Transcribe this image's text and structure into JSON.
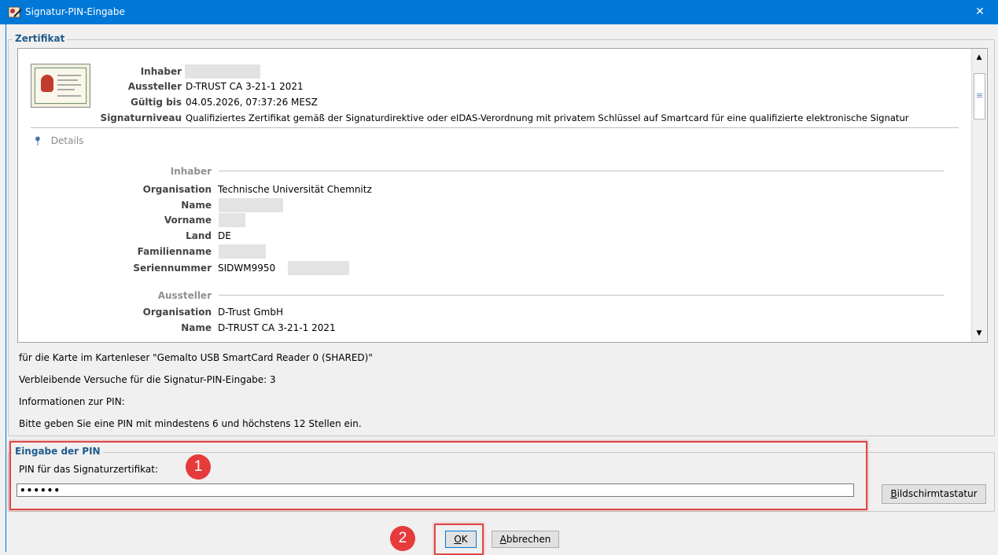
{
  "window": {
    "title": "Signatur-PIN-Eingabe",
    "close_glyph": "✕"
  },
  "certificate_group": {
    "title": "Zertifikat"
  },
  "summary": {
    "inhaber_label": "Inhaber",
    "aussteller_label": "Aussteller",
    "aussteller_value": "D-TRUST CA 3-21-1 2021",
    "gueltig_label": "Gültig bis",
    "gueltig_value": "04.05.2026, 07:37:26 MESZ",
    "niveau_label": "Signaturniveau",
    "niveau_value": "Qualifiziertes Zertifikat gemäß der Signaturdirektive oder eIDAS-Verordnung mit privatem Schlüssel auf Smartcard für eine qualifizierte elektronische Signatur"
  },
  "details": {
    "toggle_label": "Details",
    "inhaber_section": "Inhaber",
    "organisation_label": "Organisation",
    "organisation_value": "Technische Universität Chemnitz",
    "name_label": "Name",
    "vorname_label": "Vorname",
    "land_label": "Land",
    "land_value": "DE",
    "familienname_label": "Familienname",
    "seriennummer_label": "Seriennummer",
    "seriennummer_value": "SIDWM9950",
    "aussteller_section": "Aussteller",
    "aussteller_org_label": "Organisation",
    "aussteller_org_value": "D-Trust GmbH",
    "aussteller_name_label": "Name",
    "aussteller_name_value": "D-TRUST CA 3-21-1 2021"
  },
  "info": {
    "reader": "für die Karte im Kartenleser \"Gemalto USB SmartCard Reader 0 (SHARED)\"",
    "attempts": "Verbleibende Versuche für die Signatur-PIN-Eingabe: 3",
    "pin_info_title": "Informationen zur PIN:",
    "pin_info_text": "Bitte geben Sie eine PIN mit mindestens 6 und höchstens 12 Stellen ein."
  },
  "pin_group": {
    "title": "Eingabe der PIN",
    "field_label": "PIN für das Signaturzertifikat:",
    "masked_value": "••••••",
    "keyboard_button_mnemonic": "B",
    "keyboard_button_rest": "ildschirmtastatur"
  },
  "buttons": {
    "ok_mnemonic": "O",
    "ok_rest": "K",
    "cancel_mnemonic": "A",
    "cancel_rest": "bbrechen"
  },
  "annotations": {
    "step1": "1",
    "step2": "2",
    "highlight_color": "#e04848"
  }
}
